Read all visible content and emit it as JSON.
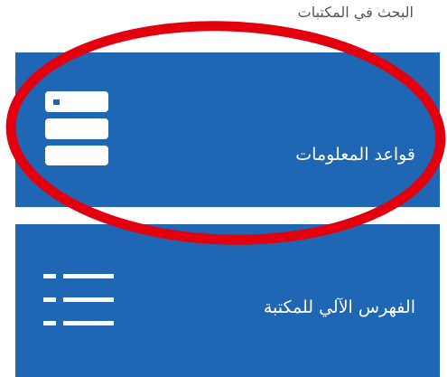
{
  "section": {
    "title": "البحث في المكتبات"
  },
  "tiles": [
    {
      "label": "قواعد المعلومات",
      "icon": "database-server-icon"
    },
    {
      "label": "الفهرس الآلي للمكتبة",
      "icon": "list-icon"
    }
  ],
  "annotation": {
    "highlight": "red-ellipse",
    "color": "#e2000f"
  },
  "colors": {
    "tile_background": "#1f66b4",
    "title_text": "#555555"
  }
}
